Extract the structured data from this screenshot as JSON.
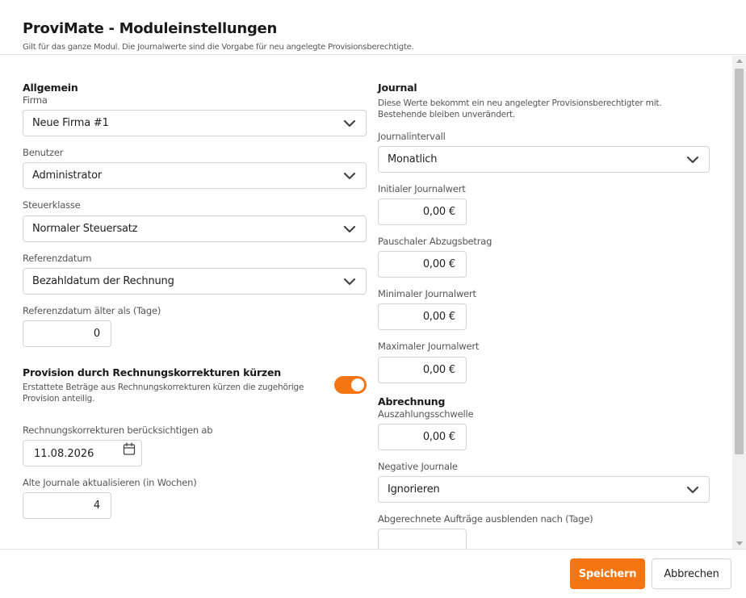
{
  "dialog": {
    "title": "ProviMate - Moduleinstellungen",
    "subtitle": "Gilt für das ganze Modul. Die Journalwerte sind die Vorgabe für neu angelegte Provisionsberechtigte."
  },
  "general": {
    "heading": "Allgemein",
    "firma": {
      "label": "Firma",
      "value": "Neue Firma #1"
    },
    "benutzer": {
      "label": "Benutzer",
      "value": "Administrator"
    },
    "steuerklasse": {
      "label": "Steuerklasse",
      "value": "Normaler Steuersatz"
    },
    "referenzdatum": {
      "label": "Referenzdatum",
      "value": "Bezahldatum der Rechnung"
    },
    "referenzdatum_aelter": {
      "label": "Referenzdatum älter als (Tage)",
      "value": "0"
    }
  },
  "corrections": {
    "heading": "Provision durch Rechnungskorrekturen kürzen",
    "description": "Erstattete Beträge aus Rechnungskorrekturen kürzen die zugehörige Provision anteilig.",
    "toggle_on": true,
    "since": {
      "label": "Rechnungskorrekturen berücksichtigen ab",
      "value": "11.08.2026"
    },
    "update_journals": {
      "label": "Alte Journale aktualisieren (in Wochen)",
      "value": "4"
    }
  },
  "journal": {
    "heading": "Journal",
    "description": "Diese Werte bekommt ein neu angelegter Provisionsberechtigter mit. Bestehende bleiben unverändert.",
    "intervall": {
      "label": "Journalintervall",
      "value": "Monatlich"
    },
    "initial": {
      "label": "Initialer Journalwert",
      "value": "0,00 €"
    },
    "pauschal": {
      "label": "Pauschaler Abzugsbetrag",
      "value": "0,00 €"
    },
    "minimal": {
      "label": "Minimaler Journalwert",
      "value": "0,00 €"
    },
    "maximal": {
      "label": "Maximaler Journalwert",
      "value": "0,00 €"
    }
  },
  "billing": {
    "heading": "Abrechnung",
    "schwelle": {
      "label": "Auszahlungsschwelle",
      "value": "0,00 €"
    },
    "negative": {
      "label": "Negative Journale",
      "value": "Ignorieren"
    },
    "hide_after": {
      "label": "Abgerechnete Aufträge ausblenden nach (Tage)"
    }
  },
  "footer": {
    "save_label": "Speichern",
    "cancel_label": "Abbrechen"
  },
  "colors": {
    "accent": "#f57512",
    "border": "#d3d3d3"
  }
}
